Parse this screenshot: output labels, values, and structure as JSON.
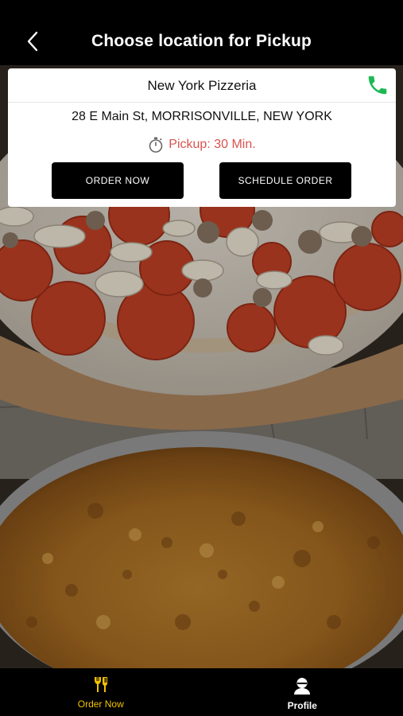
{
  "header": {
    "title": "Choose location for Pickup",
    "back_icon": "chevron-left-icon"
  },
  "location": {
    "name": "New York Pizzeria",
    "address": "28 E Main St, MORRISONVILLE, NEW YORK",
    "pickup_label": "Pickup: 30 Min.",
    "pickup_icon": "stopwatch-icon",
    "phone_icon": "phone-icon",
    "order_now_label": "ORDER NOW",
    "schedule_order_label": "SCHEDULE ORDER"
  },
  "tabs": [
    {
      "label": "Order Now",
      "icon": "utensils-icon",
      "active": true
    },
    {
      "label": "Profile",
      "icon": "profile-icon",
      "active": false
    }
  ],
  "colors": {
    "accent": "#f2c200",
    "phone": "#1db954",
    "pickup": "#d9534f",
    "bar": "#000000"
  }
}
